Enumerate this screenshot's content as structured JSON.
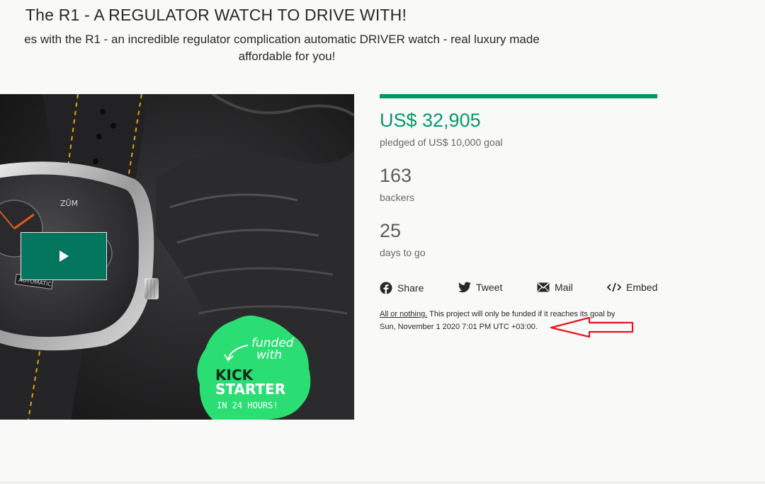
{
  "project": {
    "title": "The R1 - A REGULATOR WATCH TO DRIVE WITH!",
    "subtitle_line1": "es with the R1 - an incredible regulator complication automatic DRIVER watch - real luxury made",
    "subtitle_line2": "affordable for you!"
  },
  "media": {
    "badge_line1": "funded",
    "badge_line2": "with",
    "badge_line3": "KICK",
    "badge_line4": "STARTER",
    "badge_line5": "IN 24 HOURS!",
    "dial_brand": "ZŪM",
    "dial_label": "AUTOMATIC"
  },
  "stats": {
    "progress_fraction": 1.0,
    "pledged": "US$ 32,905",
    "pledged_label": "pledged of US$ 10,000 goal",
    "backers": "163",
    "backers_label": "backers",
    "days": "25",
    "days_label": "days to go"
  },
  "share": {
    "share_label": "Share",
    "tweet_label": "Tweet",
    "mail_label": "Mail",
    "embed_label": "Embed"
  },
  "notice": {
    "link_text": "All or nothing.",
    "text_part1": " This project will only be funded if it reaches its goal by",
    "deadline": "Sun, November 1 2020 7:01 PM UTC +03:00."
  },
  "colors": {
    "accent": "#029a6c",
    "annotation": "#e8141d"
  }
}
